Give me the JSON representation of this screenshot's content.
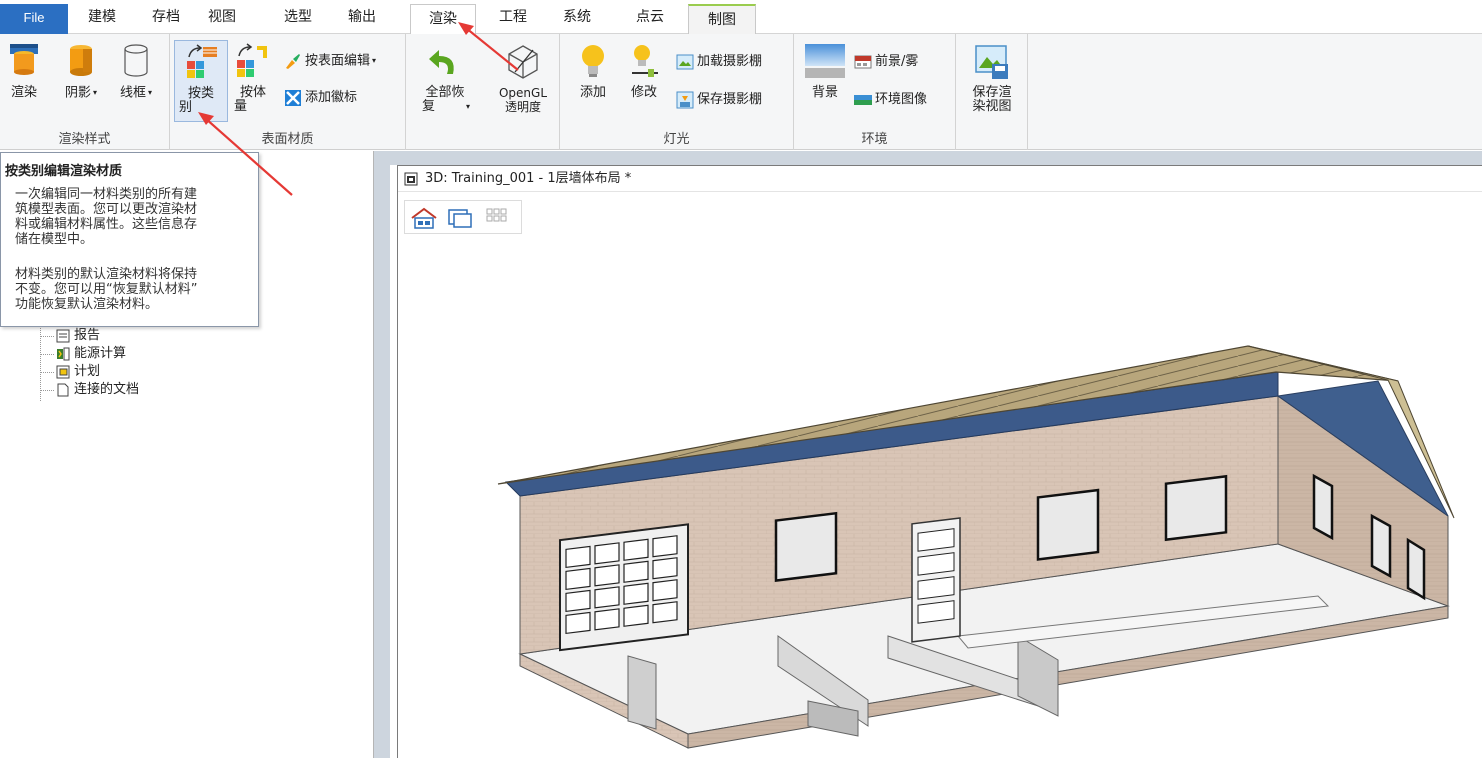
{
  "menu": {
    "tabs": [
      {
        "label": "File"
      },
      {
        "label": "建模"
      },
      {
        "label": "存档"
      },
      {
        "label": "视图"
      },
      {
        "label": "选型"
      },
      {
        "label": "输出"
      },
      {
        "label": "渲染"
      },
      {
        "label": "工程"
      },
      {
        "label": "系统"
      },
      {
        "label": "点云"
      },
      {
        "label": "制图"
      }
    ],
    "active": "渲染"
  },
  "ribbon": {
    "groups": [
      {
        "label": "渲染样式",
        "buttons": [
          {
            "label": "渲染"
          },
          {
            "label": "阴影"
          },
          {
            "label": "线框"
          }
        ]
      },
      {
        "label": "表面材质",
        "buttons": [
          {
            "label": "按类别",
            "line1": "按类",
            "line2": "别"
          },
          {
            "label": "按体量",
            "line1": "按体",
            "line2": "量"
          }
        ],
        "small": [
          {
            "label": "按表面编辑"
          },
          {
            "label": "添加徽标"
          }
        ]
      },
      {
        "label": "",
        "buttons": [
          {
            "label": "全部恢复",
            "line1": "全部恢",
            "line2": "复"
          },
          {
            "label": "OpenGL透明度",
            "line1": "OpenGL",
            "line2": "透明度"
          }
        ]
      },
      {
        "label": "灯光",
        "buttons": [
          {
            "label": "添加"
          },
          {
            "label": "修改"
          }
        ],
        "small": [
          {
            "label": "加载摄影棚"
          },
          {
            "label": "保存摄影棚"
          }
        ]
      },
      {
        "label": "环境",
        "buttons": [
          {
            "label": "背景"
          }
        ],
        "small": [
          {
            "label": "前景/雾"
          },
          {
            "label": "环境图像"
          }
        ]
      },
      {
        "label": "",
        "buttons": [
          {
            "label": "保存渲染视图",
            "line1": "保存渲",
            "line2": "染视图"
          }
        ]
      }
    ]
  },
  "tooltip": {
    "title": "按类别编辑渲染材质",
    "paragraph1_lines": [
      "一次编辑同一材料类别的所有建",
      "筑模型表面。您可以更改渲染材",
      "料或编辑材料属性。这些信息存",
      "储在模型中。"
    ],
    "paragraph2_lines": [
      "材料类别的默认渲染材料将保持",
      "不变。您可以用“恢复默认材料”",
      "功能恢复默认渲染材料。"
    ]
  },
  "tree": {
    "items": [
      {
        "label": "报告",
        "icon": "report-icon"
      },
      {
        "label": "能源计算",
        "icon": "energy-icon"
      },
      {
        "label": "计划",
        "icon": "plan-icon"
      },
      {
        "label": "连接的文档",
        "icon": "document-icon"
      }
    ]
  },
  "viewport": {
    "title": "3D: Training_001 - 1层墙体布局 *",
    "tools": [
      "home-view-icon",
      "window-icon",
      "grid-icon"
    ]
  },
  "colors": {
    "file_tab": "#2b6fc2",
    "ribbon_bg": "#f5f6f7",
    "annotation_arrow": "#e53935",
    "wall": "#d8c3b3",
    "roof": "#b6a47a",
    "gable": "#3f5f8e"
  }
}
